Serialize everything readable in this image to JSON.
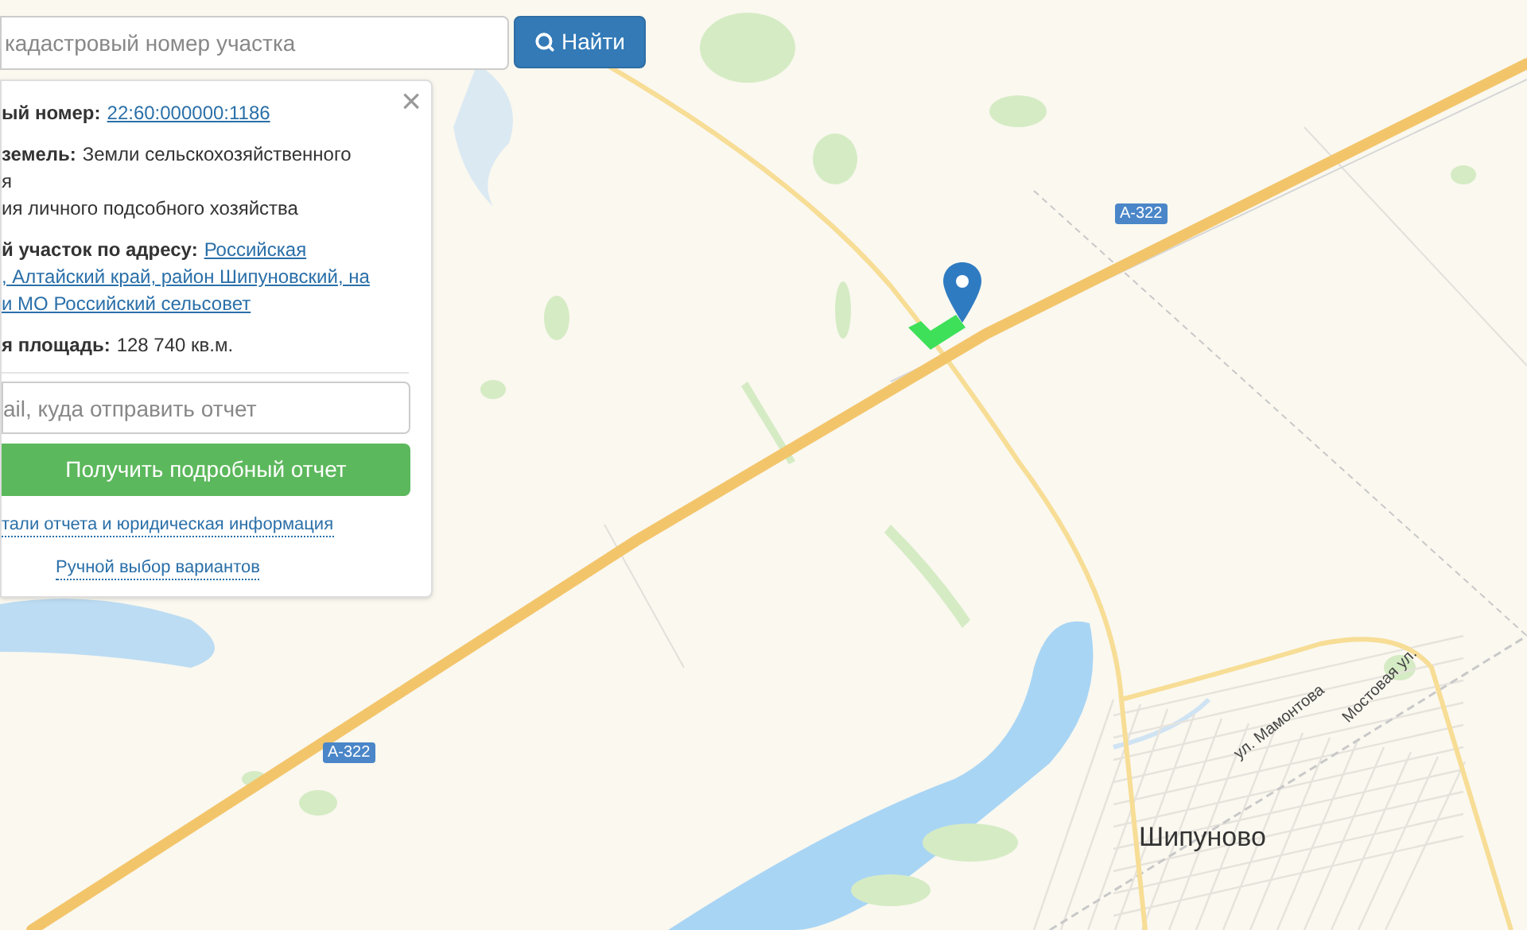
{
  "search": {
    "placeholder": "кадастровый номер участка",
    "button": "Найти"
  },
  "info_panel": {
    "close": "×",
    "sections": [
      {
        "lines": [
          {
            "label": "ый номер:",
            "value": "22:60:000000:1186",
            "link": true
          }
        ]
      },
      {
        "lines": [
          {
            "label": "земель:",
            "value": "Земли сельскохозяйственного",
            "link": false
          },
          {
            "value": "я",
            "link": false
          },
          {
            "value": "ия личного подсобного хозяйства",
            "link": false
          }
        ]
      },
      {
        "lines": [
          {
            "label": "й участок по адресу:",
            "value": "Российская",
            "link": true
          },
          {
            "value": ", Алтайский край, район Шипуновский, на",
            "link": true
          },
          {
            "value": "и МО Российский сельсовет",
            "link": true
          }
        ]
      },
      {
        "lines": [
          {
            "label": "я площадь:",
            "value": "128 740 кв.м.",
            "link": false
          }
        ]
      }
    ],
    "email_placeholder": "ail, куда отправить отчет",
    "submit": "Получить подробный отчет",
    "links": [
      "тали отчета и юридическая информация",
      "Ручной выбор вариантов"
    ]
  },
  "map": {
    "road_badges": [
      "А-322",
      "А-322"
    ],
    "town": "Шипуново",
    "streets": [
      "ул. Мамонтова",
      "Мостовая ул."
    ]
  }
}
